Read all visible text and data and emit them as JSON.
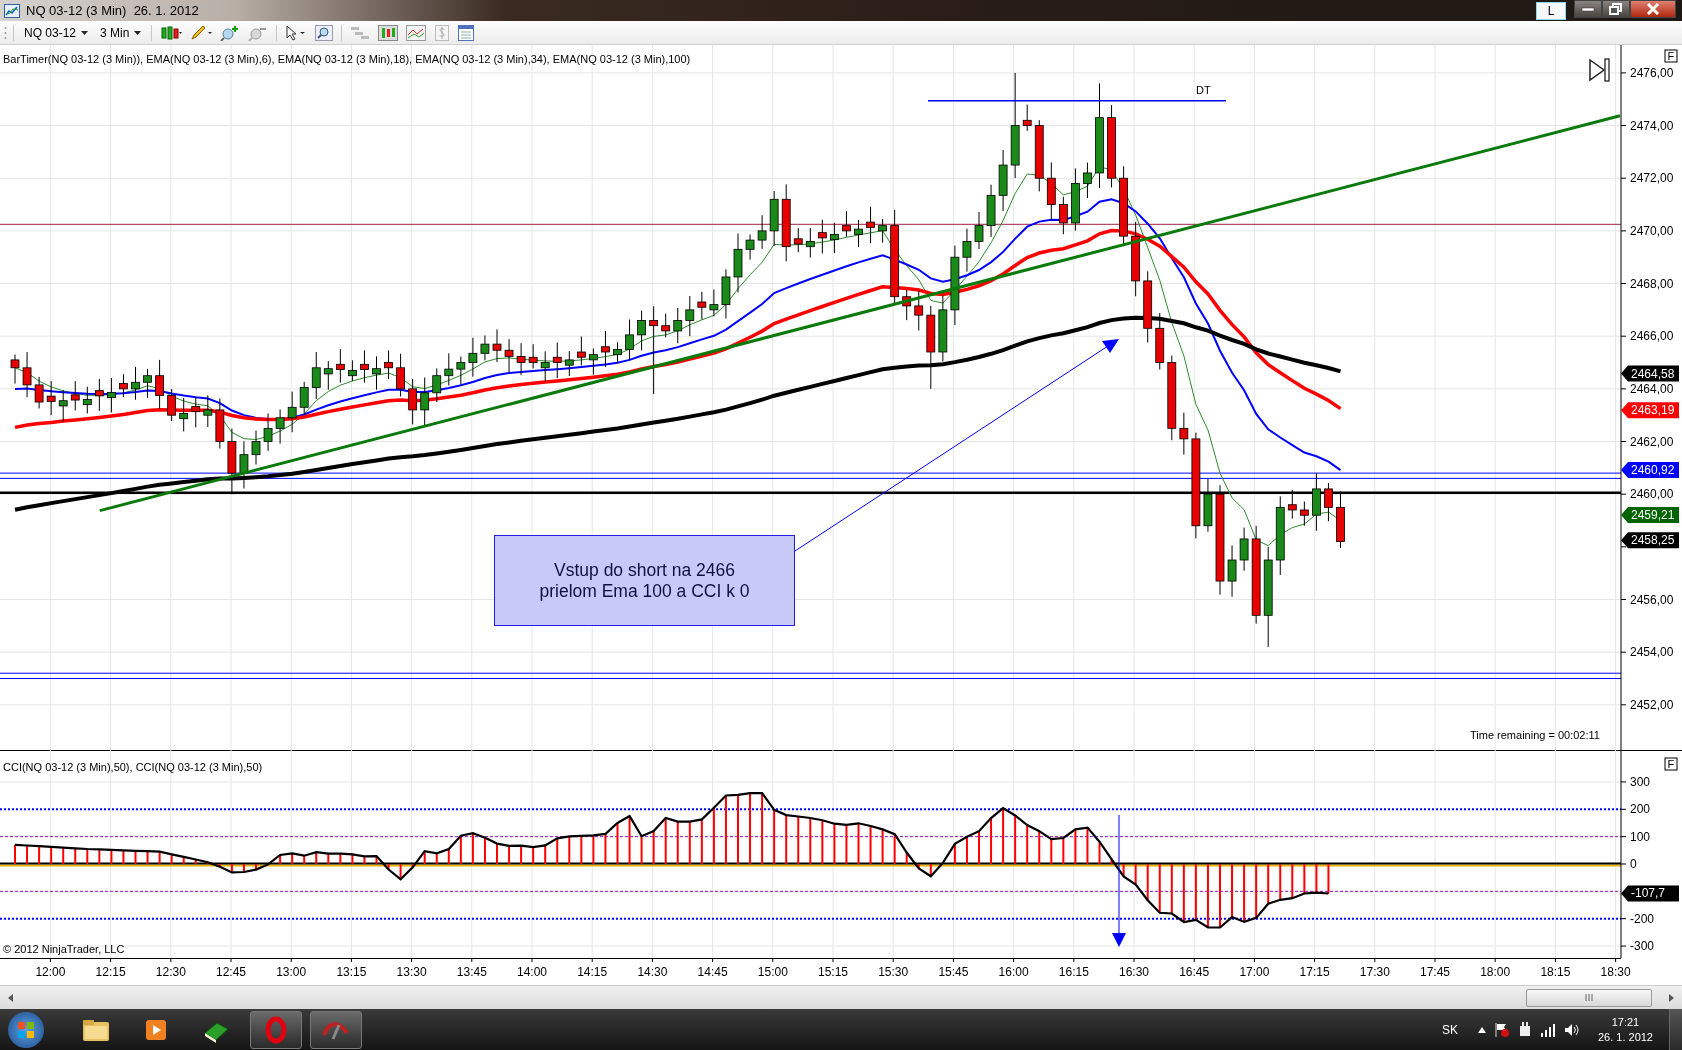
{
  "window": {
    "title": "NQ 03-12 (3 Min)  26. 1. 2012",
    "language_button": "L"
  },
  "toolbar": {
    "instrument": "NQ 03-12",
    "interval": "3 Min"
  },
  "price_panel": {
    "indicator_label": "BarTimer(NQ 03-12 (3 Min)), EMA(NQ 03-12 (3 Min),6), EMA(NQ 03-12 (3 Min),18), EMA(NQ 03-12 (3 Min),34), EMA(NQ 03-12 (3 Min),100)",
    "ticks": [
      "2476,00",
      "2474,00",
      "2472,00",
      "2470,00",
      "2468,00",
      "2466,00",
      "2464,00",
      "2462,00",
      "2460,00",
      "2456,00",
      "2454,00",
      "2452,00"
    ],
    "price_tags": [
      {
        "text": "2464,58",
        "color": "#000000"
      },
      {
        "text": "2463,19",
        "color": "#ff0000"
      },
      {
        "text": "2460,92",
        "color": "#0000ff"
      },
      {
        "text": "2459,21",
        "color": "#006400"
      },
      {
        "text": "2458,25",
        "color": "#000000"
      }
    ],
    "dt_label": "DT",
    "annotation": "Vstup do short na 2466\nprielom Ema 100 a CCI k 0",
    "time_remaining": "Time remaining = 00:02:11",
    "panel_button": "F"
  },
  "cci_panel": {
    "indicator_label": "CCI(NQ 03-12 (3 Min),50), CCI(NQ 03-12 (3 Min),50)",
    "ticks": [
      "300",
      "200",
      "100",
      "0",
      "-200",
      "-300"
    ],
    "value_tag": "-107,7",
    "copyright": "© 2012 NinjaTrader, LLC",
    "panel_button": "F"
  },
  "time_axis": {
    "labels": [
      "12:00",
      "12:15",
      "12:30",
      "12:45",
      "13:00",
      "13:15",
      "13:30",
      "13:45",
      "14:00",
      "14:15",
      "14:30",
      "14:45",
      "15:00",
      "15:15",
      "15:30",
      "15:45",
      "16:00",
      "16:15",
      "16:30",
      "16:45",
      "17:00",
      "17:15",
      "17:30",
      "17:45",
      "18:00",
      "18:15",
      "18:30"
    ]
  },
  "taskbar": {
    "language": "SK",
    "time": "17:21",
    "date": "26. 1. 2012"
  }
}
